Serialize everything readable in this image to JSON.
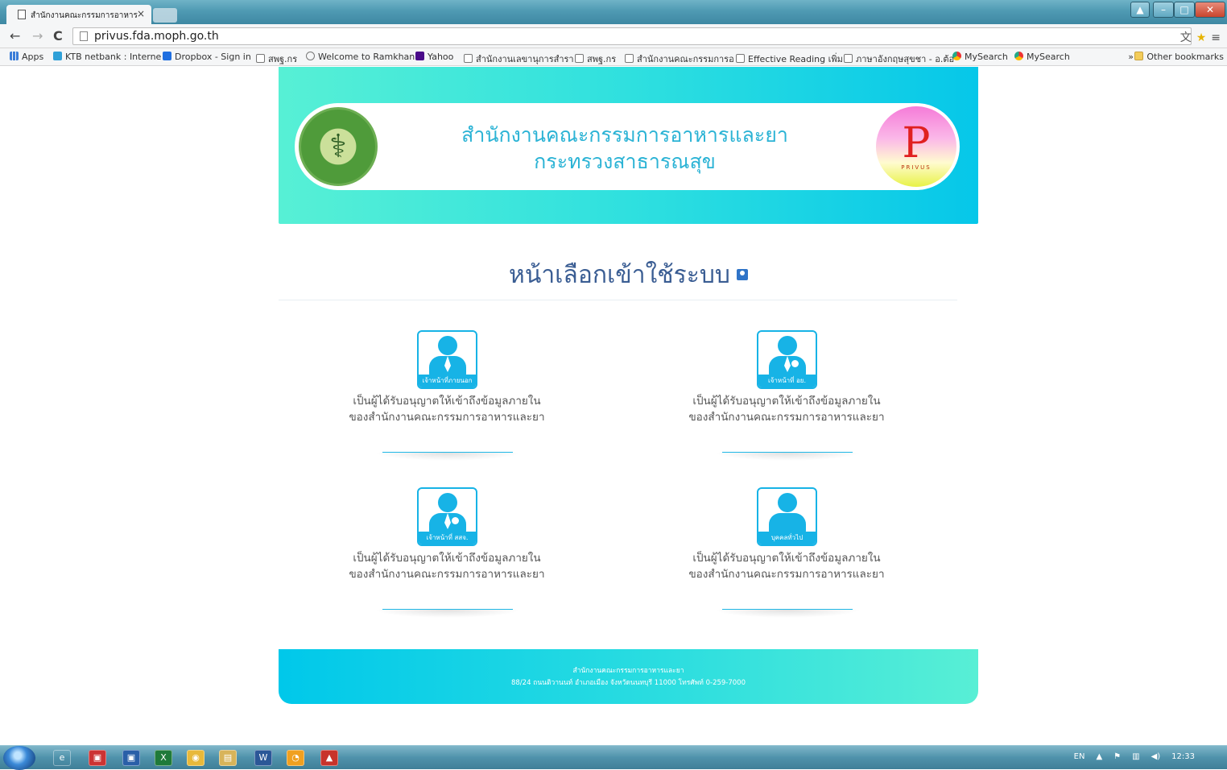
{
  "browser": {
    "tab_title": "สำนักงานคณะกรรมการอาหาร",
    "tab_close": "×",
    "url": "privus.fda.moph.go.th",
    "bookmarks": [
      {
        "label": "Apps",
        "kind": "apps"
      },
      {
        "label": "KTB netbank : Interne",
        "kind": "ktb"
      },
      {
        "label": "Dropbox - Sign in",
        "kind": "drop"
      },
      {
        "label": "สพฐ.กร",
        "kind": "page"
      },
      {
        "label": "Welcome to Ramkhan",
        "kind": "ram"
      },
      {
        "label": "Yahoo",
        "kind": "yahoo"
      },
      {
        "label": "สำนักงานเลขานุการสำรา",
        "kind": "page"
      },
      {
        "label": "สพฐ.กร",
        "kind": "page"
      },
      {
        "label": "สำนักงานคณะกรรมการอ",
        "kind": "page"
      },
      {
        "label": "Effective Reading เพิ่ม",
        "kind": "page"
      },
      {
        "label": "ภาษาอังกฤษสุขชา - อ.ต้อ",
        "kind": "page"
      },
      {
        "label": "MySearch",
        "kind": "my"
      },
      {
        "label": "MySearch",
        "kind": "my"
      }
    ],
    "more_bookmarks": "»",
    "other_bookmarks": "Other bookmarks"
  },
  "header": {
    "org_line1": "สำนักงานคณะกรรมการอาหารและยา",
    "org_line2": "กระทรวงสาธารณสุข",
    "privus_letter": "P",
    "privus_word": "PRIVUS"
  },
  "main": {
    "title": "หน้าเลือกเข้าใช้ระบบ",
    "cards": [
      {
        "label": "เจ้าหน้าที่ภายนอก",
        "desc1": "เป็นผู้ได้รับอนุญาตให้เข้าถึงข้อมูลภายใน",
        "desc2": "ของสำนักงานคณะกรรมการอาหารและยา"
      },
      {
        "label": "เจ้าหน้าที่ อย.",
        "desc1": "เป็นผู้ได้รับอนุญาตให้เข้าถึงข้อมูลภายใน",
        "desc2": "ของสำนักงานคณะกรรมการอาหารและยา"
      },
      {
        "label": "เจ้าหน้าที่ สสจ.",
        "desc1": "เป็นผู้ได้รับอนุญาตให้เข้าถึงข้อมูลภายใน",
        "desc2": "ของสำนักงานคณะกรรมการอาหารและยา"
      },
      {
        "label": "บุคคลทั่วไป",
        "desc1": "เป็นผู้ได้รับอนุญาตให้เข้าถึงข้อมูลภายใน",
        "desc2": "ของสำนักงานคณะกรรมการอาหารและยา"
      }
    ]
  },
  "footer": {
    "line1": "สำนักงานคณะกรรมการอาหารและยา",
    "line2": "88/24 ถนนติวานนท์ อำเภอเมือง จังหวัดนนทบุรี 11000 โทรศัพท์ 0-259-7000"
  },
  "taskbar": {
    "lang": "EN",
    "clock": "12:33"
  }
}
